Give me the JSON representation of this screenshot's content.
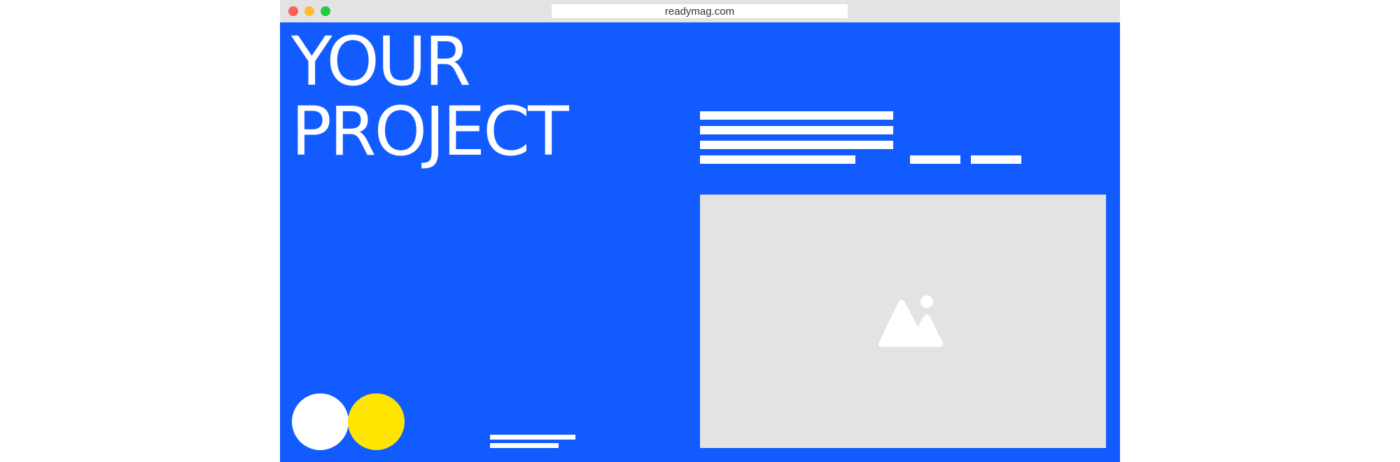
{
  "browser": {
    "url": "readymag.com",
    "controls": {
      "close_color": "#ff5f57",
      "minimize_color": "#febc2e",
      "maximize_color": "#28c840"
    }
  },
  "page": {
    "background_color": "#125bff",
    "headline": {
      "line1": "YOUR",
      "line2": "PROJECT"
    },
    "text_placeholder_color": "#ffffff",
    "image_placeholder": {
      "background_color": "#e3e3e3",
      "icon": "image-mountain-icon"
    },
    "circles": [
      {
        "color": "#ffffff"
      },
      {
        "color": "#ffe600"
      }
    ]
  }
}
